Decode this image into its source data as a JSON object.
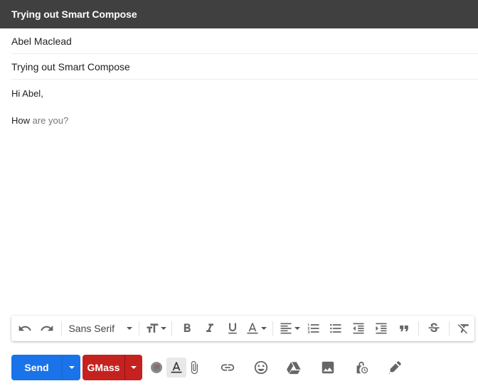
{
  "window": {
    "title": "Trying out Smart Compose"
  },
  "compose": {
    "to": "Abel Maclead",
    "subject": "Trying out Smart Compose",
    "body": {
      "greeting": "Hi Abel,",
      "typed": "How",
      "suggestion": " are you?"
    }
  },
  "formatting_toolbar": {
    "undo": "undo-icon",
    "redo": "redo-icon",
    "font_family": "Sans Serif",
    "font_size": "text-size-icon",
    "bold": "bold-icon",
    "italic": "italic-icon",
    "underline": "underline-icon",
    "text_color": "text-color-icon",
    "align": "align-icon",
    "numbered_list": "numbered-list-icon",
    "bulleted_list": "bulleted-list-icon",
    "indent_less": "indent-less-icon",
    "indent_more": "indent-more-icon",
    "quote": "quote-icon",
    "strikethrough": "strikethrough-icon",
    "remove_formatting": "remove-formatting-icon"
  },
  "bottom_bar": {
    "send_label": "Send",
    "gmass_label": "GMass",
    "colors": {
      "send": "#1a73e8",
      "gmass": "#c5221f",
      "titlebar": "#404040"
    },
    "icons": [
      "gmass-settings-icon",
      "formatting-options-icon",
      "attach-icon",
      "link-icon",
      "emoji-icon",
      "drive-icon",
      "photo-icon",
      "confidential-mode-icon",
      "signature-icon"
    ]
  }
}
